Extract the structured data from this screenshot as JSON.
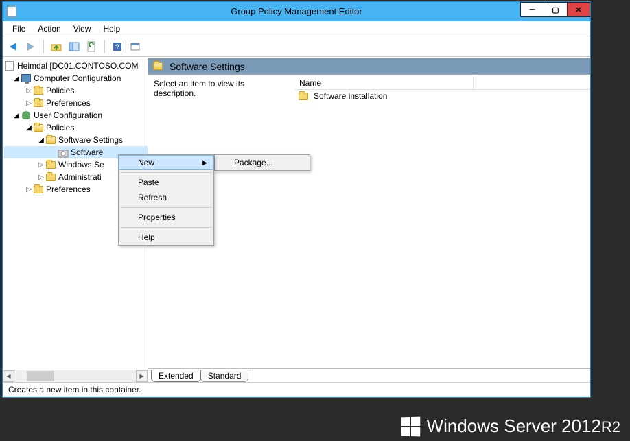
{
  "window": {
    "title": "Group Policy Management Editor"
  },
  "menus": {
    "file": "File",
    "action": "Action",
    "view": "View",
    "help": "Help"
  },
  "tree": {
    "root": "Heimdal [DC01.CONTOSO.COM",
    "comp_conf": "Computer Configuration",
    "comp_policies": "Policies",
    "comp_prefs": "Preferences",
    "user_conf": "User Configuration",
    "user_policies": "Policies",
    "software_settings": "Software Settings",
    "software_install": "Software",
    "windows_settings": "Windows Se",
    "admin_templates": "Administrati",
    "user_prefs": "Preferences"
  },
  "detail": {
    "heading": "Software Settings",
    "desc": "Select an item to view its description.",
    "col_name": "Name",
    "item1": "Software installation"
  },
  "tabs": {
    "extended": "Extended",
    "standard": "Standard"
  },
  "status": "Creates a new item in this container.",
  "context": {
    "new": "New",
    "paste": "Paste",
    "refresh": "Refresh",
    "properties": "Properties",
    "help": "Help",
    "package": "Package..."
  },
  "branding": {
    "text": "Windows Server 2012",
    "suffix": "R2"
  }
}
